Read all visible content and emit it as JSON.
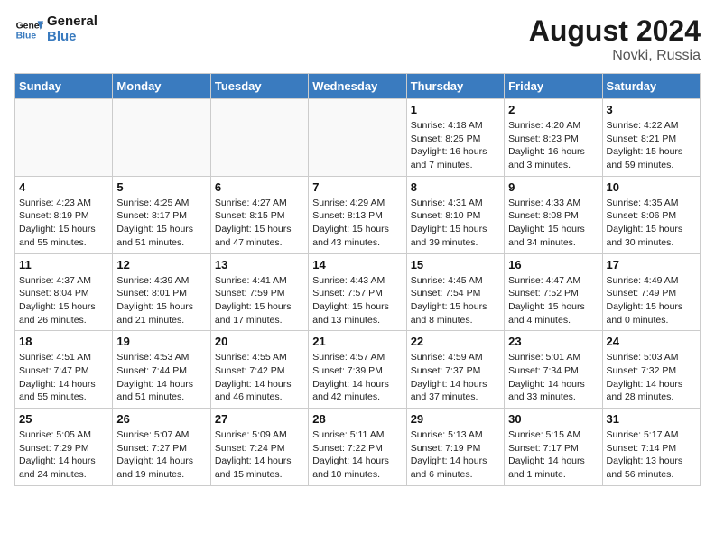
{
  "header": {
    "logo_line1": "General",
    "logo_line2": "Blue",
    "month_year": "August 2024",
    "location": "Novki, Russia"
  },
  "weekdays": [
    "Sunday",
    "Monday",
    "Tuesday",
    "Wednesday",
    "Thursday",
    "Friday",
    "Saturday"
  ],
  "weeks": [
    [
      {
        "day": "",
        "info": ""
      },
      {
        "day": "",
        "info": ""
      },
      {
        "day": "",
        "info": ""
      },
      {
        "day": "",
        "info": ""
      },
      {
        "day": "1",
        "info": "Sunrise: 4:18 AM\nSunset: 8:25 PM\nDaylight: 16 hours\nand 7 minutes."
      },
      {
        "day": "2",
        "info": "Sunrise: 4:20 AM\nSunset: 8:23 PM\nDaylight: 16 hours\nand 3 minutes."
      },
      {
        "day": "3",
        "info": "Sunrise: 4:22 AM\nSunset: 8:21 PM\nDaylight: 15 hours\nand 59 minutes."
      }
    ],
    [
      {
        "day": "4",
        "info": "Sunrise: 4:23 AM\nSunset: 8:19 PM\nDaylight: 15 hours\nand 55 minutes."
      },
      {
        "day": "5",
        "info": "Sunrise: 4:25 AM\nSunset: 8:17 PM\nDaylight: 15 hours\nand 51 minutes."
      },
      {
        "day": "6",
        "info": "Sunrise: 4:27 AM\nSunset: 8:15 PM\nDaylight: 15 hours\nand 47 minutes."
      },
      {
        "day": "7",
        "info": "Sunrise: 4:29 AM\nSunset: 8:13 PM\nDaylight: 15 hours\nand 43 minutes."
      },
      {
        "day": "8",
        "info": "Sunrise: 4:31 AM\nSunset: 8:10 PM\nDaylight: 15 hours\nand 39 minutes."
      },
      {
        "day": "9",
        "info": "Sunrise: 4:33 AM\nSunset: 8:08 PM\nDaylight: 15 hours\nand 34 minutes."
      },
      {
        "day": "10",
        "info": "Sunrise: 4:35 AM\nSunset: 8:06 PM\nDaylight: 15 hours\nand 30 minutes."
      }
    ],
    [
      {
        "day": "11",
        "info": "Sunrise: 4:37 AM\nSunset: 8:04 PM\nDaylight: 15 hours\nand 26 minutes."
      },
      {
        "day": "12",
        "info": "Sunrise: 4:39 AM\nSunset: 8:01 PM\nDaylight: 15 hours\nand 21 minutes."
      },
      {
        "day": "13",
        "info": "Sunrise: 4:41 AM\nSunset: 7:59 PM\nDaylight: 15 hours\nand 17 minutes."
      },
      {
        "day": "14",
        "info": "Sunrise: 4:43 AM\nSunset: 7:57 PM\nDaylight: 15 hours\nand 13 minutes."
      },
      {
        "day": "15",
        "info": "Sunrise: 4:45 AM\nSunset: 7:54 PM\nDaylight: 15 hours\nand 8 minutes."
      },
      {
        "day": "16",
        "info": "Sunrise: 4:47 AM\nSunset: 7:52 PM\nDaylight: 15 hours\nand 4 minutes."
      },
      {
        "day": "17",
        "info": "Sunrise: 4:49 AM\nSunset: 7:49 PM\nDaylight: 15 hours\nand 0 minutes."
      }
    ],
    [
      {
        "day": "18",
        "info": "Sunrise: 4:51 AM\nSunset: 7:47 PM\nDaylight: 14 hours\nand 55 minutes."
      },
      {
        "day": "19",
        "info": "Sunrise: 4:53 AM\nSunset: 7:44 PM\nDaylight: 14 hours\nand 51 minutes."
      },
      {
        "day": "20",
        "info": "Sunrise: 4:55 AM\nSunset: 7:42 PM\nDaylight: 14 hours\nand 46 minutes."
      },
      {
        "day": "21",
        "info": "Sunrise: 4:57 AM\nSunset: 7:39 PM\nDaylight: 14 hours\nand 42 minutes."
      },
      {
        "day": "22",
        "info": "Sunrise: 4:59 AM\nSunset: 7:37 PM\nDaylight: 14 hours\nand 37 minutes."
      },
      {
        "day": "23",
        "info": "Sunrise: 5:01 AM\nSunset: 7:34 PM\nDaylight: 14 hours\nand 33 minutes."
      },
      {
        "day": "24",
        "info": "Sunrise: 5:03 AM\nSunset: 7:32 PM\nDaylight: 14 hours\nand 28 minutes."
      }
    ],
    [
      {
        "day": "25",
        "info": "Sunrise: 5:05 AM\nSunset: 7:29 PM\nDaylight: 14 hours\nand 24 minutes."
      },
      {
        "day": "26",
        "info": "Sunrise: 5:07 AM\nSunset: 7:27 PM\nDaylight: 14 hours\nand 19 minutes."
      },
      {
        "day": "27",
        "info": "Sunrise: 5:09 AM\nSunset: 7:24 PM\nDaylight: 14 hours\nand 15 minutes."
      },
      {
        "day": "28",
        "info": "Sunrise: 5:11 AM\nSunset: 7:22 PM\nDaylight: 14 hours\nand 10 minutes."
      },
      {
        "day": "29",
        "info": "Sunrise: 5:13 AM\nSunset: 7:19 PM\nDaylight: 14 hours\nand 6 minutes."
      },
      {
        "day": "30",
        "info": "Sunrise: 5:15 AM\nSunset: 7:17 PM\nDaylight: 14 hours\nand 1 minute."
      },
      {
        "day": "31",
        "info": "Sunrise: 5:17 AM\nSunset: 7:14 PM\nDaylight: 13 hours\nand 56 minutes."
      }
    ]
  ]
}
